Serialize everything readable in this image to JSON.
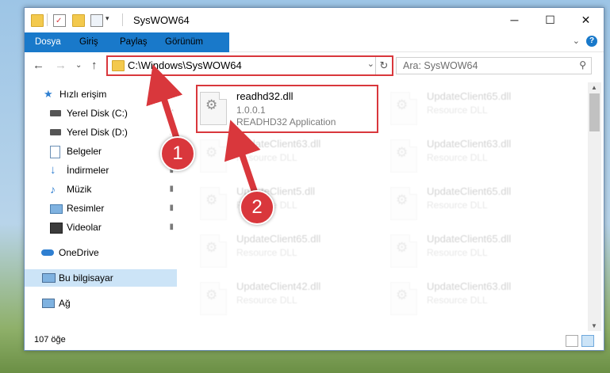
{
  "window": {
    "title": "SysWOW64",
    "controls": {
      "minimize": "─",
      "maximize": "☐",
      "close": "✕"
    }
  },
  "ribbon": {
    "tabs": [
      "Dosya",
      "Giriş",
      "Paylaş",
      "Görünüm"
    ],
    "expand": "⌄",
    "help": "?"
  },
  "nav": {
    "back": "←",
    "forward": "→",
    "recent": "⌄",
    "up": "↑",
    "address": "C:\\Windows\\SysWOW64",
    "address_dropdown": "⌄",
    "refresh": "↻",
    "search_placeholder": "Ara: SysWOW64",
    "search_icon": "⚲"
  },
  "sidebar": {
    "items": [
      {
        "label": "Hızlı erişim",
        "icon": "star-icon",
        "pinned": false
      },
      {
        "label": "Yerel Disk (C:)",
        "icon": "drive-icon",
        "pinned": true
      },
      {
        "label": "Yerel Disk (D:)",
        "icon": "drive-icon",
        "pinned": true
      },
      {
        "label": "Belgeler",
        "icon": "documents-icon",
        "pinned": true
      },
      {
        "label": "İndirmeler",
        "icon": "download-icon",
        "pinned": true
      },
      {
        "label": "Müzik",
        "icon": "music-icon",
        "pinned": true
      },
      {
        "label": "Resimler",
        "icon": "pictures-icon",
        "pinned": true
      },
      {
        "label": "Videolar",
        "icon": "video-icon",
        "pinned": true
      },
      {
        "label": "OneDrive",
        "icon": "cloud-icon",
        "pinned": false
      },
      {
        "label": "Bu bilgisayar",
        "icon": "computer-icon",
        "pinned": false,
        "selected": true
      },
      {
        "label": "Ağ",
        "icon": "network-icon",
        "pinned": false
      }
    ],
    "pin_glyph": "📌"
  },
  "files": {
    "highlighted": {
      "name": "readhd32.dll",
      "version": "1.0.0.1",
      "description": "READHD32 Application"
    },
    "others": [
      {
        "name": "UpdateClient65.dll",
        "desc": "Resource DLL"
      },
      {
        "name": "UpdateClient63.dll",
        "desc": "Resource DLL"
      },
      {
        "name": "UpdateClient63.dll",
        "desc": "Resource DLL"
      },
      {
        "name": "UpdateClient5.dll",
        "desc": "Resource DLL"
      },
      {
        "name": "UpdateClient65.dll",
        "desc": "Resource DLL"
      },
      {
        "name": "UpdateClient65.dll",
        "desc": "Resource DLL"
      },
      {
        "name": "UpdateClient65.dll",
        "desc": "Resource DLL"
      },
      {
        "name": "UpdateClient42.dll",
        "desc": "Resource DLL"
      },
      {
        "name": "UpdateClient63.dll",
        "desc": "Resource DLL"
      }
    ]
  },
  "status": {
    "item_count": "107 öğe"
  },
  "annotations": {
    "step1": "1",
    "step2": "2",
    "color": "#d9373c"
  }
}
